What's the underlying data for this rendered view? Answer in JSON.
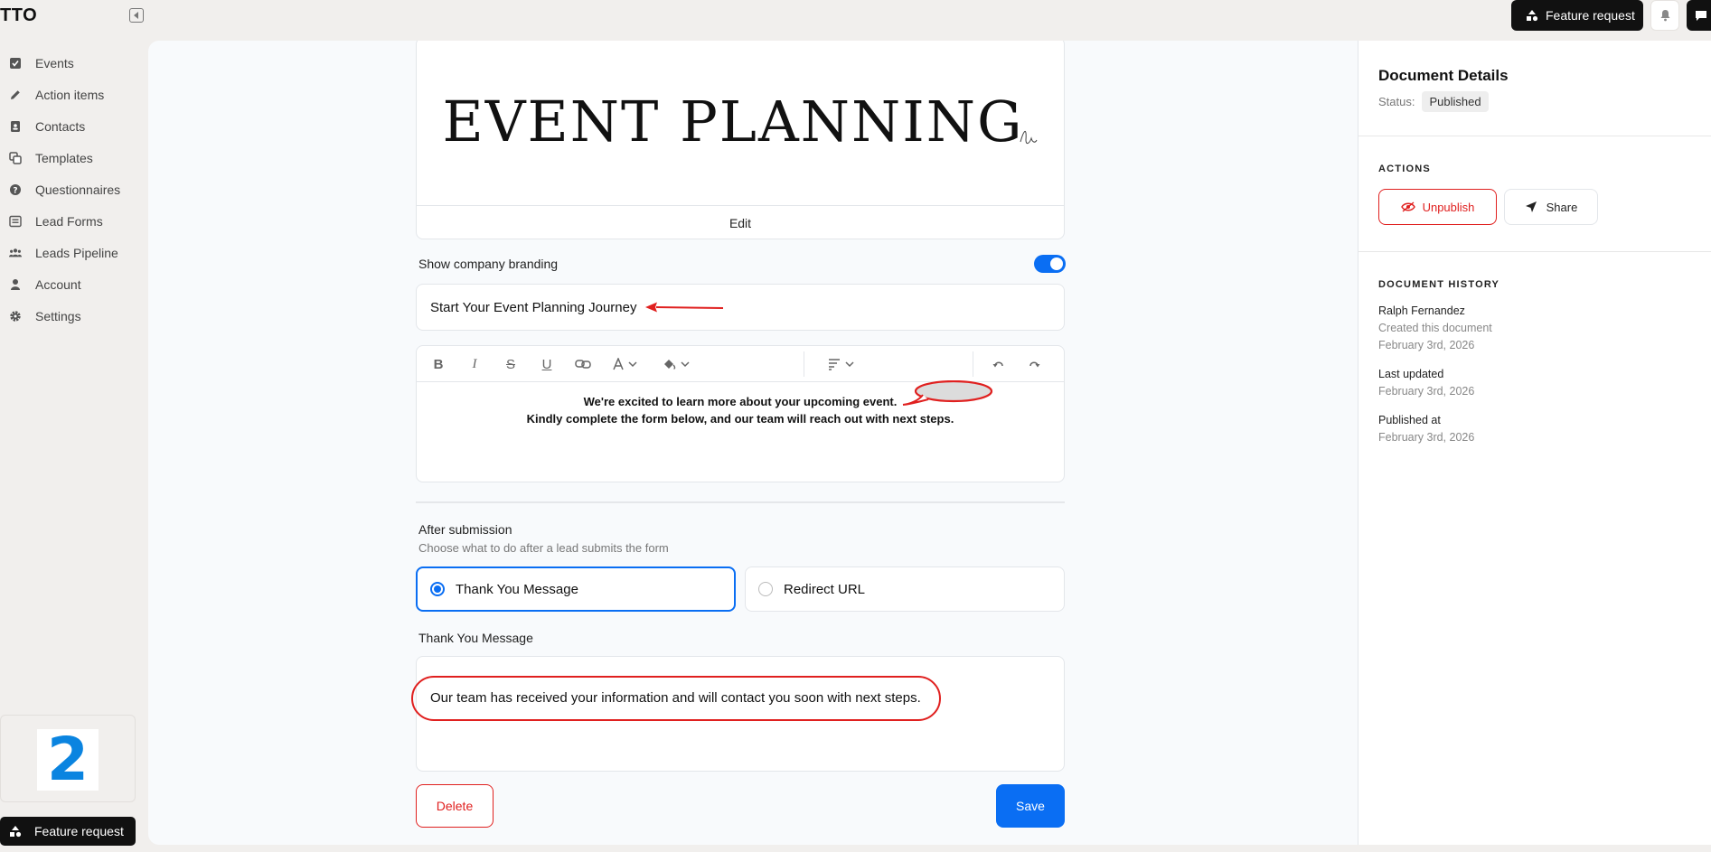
{
  "app": {
    "brand": "TTO"
  },
  "topbar": {
    "feature_request": "Feature request"
  },
  "sidebar": {
    "items": [
      {
        "label": "Events",
        "icon": "check-square-icon"
      },
      {
        "label": "Action items",
        "icon": "pencil-icon"
      },
      {
        "label": "Contacts",
        "icon": "contact-book-icon"
      },
      {
        "label": "Templates",
        "icon": "copy-icon"
      },
      {
        "label": "Questionnaires",
        "icon": "question-circle-icon"
      },
      {
        "label": "Lead Forms",
        "icon": "form-icon"
      },
      {
        "label": "Leads Pipeline",
        "icon": "users-icon"
      },
      {
        "label": "Account",
        "icon": "user-icon"
      },
      {
        "label": "Settings",
        "icon": "gear-icon"
      }
    ],
    "promo_number": "2",
    "feature_request": "Feature request"
  },
  "editor": {
    "header_image_text": "EVENT PLANNING",
    "edit_label": "Edit",
    "show_branding_label": "Show company branding",
    "show_branding_on": true,
    "form_title": "Start Your Event Planning Journey",
    "body_line1": "We're excited to learn more about your upcoming event.",
    "body_line2": "Kindly complete the form below, and our team will reach out with next steps.",
    "after_submission_title": "After submission",
    "after_submission_sub": "Choose what to do after a lead submits the form",
    "options": [
      {
        "label": "Thank You Message",
        "selected": true
      },
      {
        "label": "Redirect URL",
        "selected": false
      }
    ],
    "thank_you_label": "Thank You Message",
    "thank_you_text": "Our team has received your information and will contact you soon with next steps.",
    "delete_label": "Delete",
    "save_label": "Save"
  },
  "details": {
    "title": "Document Details",
    "status_label": "Status:",
    "status_value": "Published",
    "actions_heading": "ACTIONS",
    "unpublish_label": "Unpublish",
    "share_label": "Share",
    "history_heading": "DOCUMENT HISTORY",
    "history": [
      {
        "line1": "Ralph Fernandez",
        "line2": "Created this document",
        "line3": "February 3rd, 2026"
      },
      {
        "line1": "Last updated",
        "line2": "February 3rd, 2026"
      },
      {
        "line1": "Published at",
        "line2": "February 3rd, 2026"
      }
    ]
  },
  "colors": {
    "accent": "#0a6ef3",
    "danger": "#e0201f",
    "annotation": "#e0201f"
  }
}
